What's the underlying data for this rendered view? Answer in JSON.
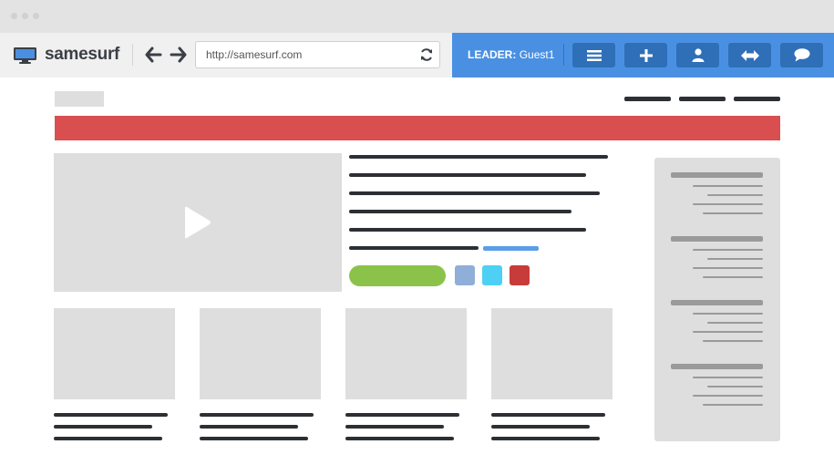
{
  "app": {
    "brand": "samesurf",
    "url": "http://samesurf.com",
    "leader_prefix": "LEADER:",
    "leader_name": "Guest1"
  },
  "icons": {
    "logo": "monitor-icon",
    "back": "arrow-left-icon",
    "forward": "arrow-right-icon",
    "refresh": "refresh-icon",
    "menu": "menu-icon",
    "add": "plus-icon",
    "user": "user-icon",
    "swap": "swap-arrows-icon",
    "chat": "chat-bubble-icon",
    "play": "play-icon"
  },
  "colors": {
    "leader_panel": "#4a90e2",
    "toolbar_button": "#2f6fb8",
    "banner": "#d94f4f",
    "primary_button": "#8bc34a",
    "link_line": "#5a9ee6",
    "swatch_1": "#8faed8",
    "swatch_2": "#4ed0f5",
    "swatch_3": "#c83b3b"
  }
}
